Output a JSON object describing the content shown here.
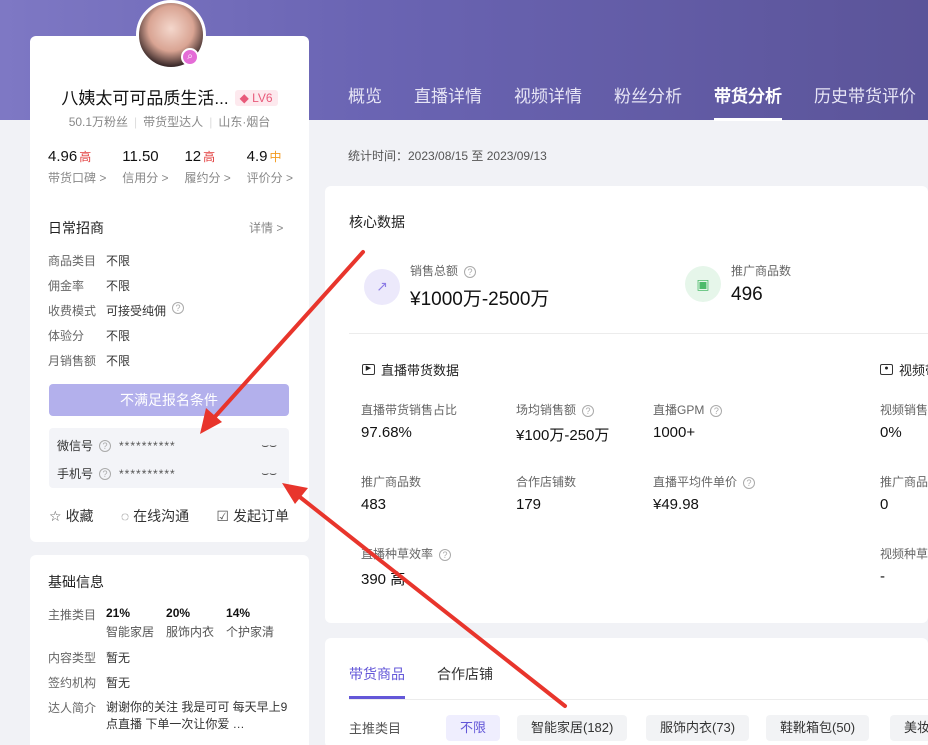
{
  "tabs": [
    "概览",
    "直播详情",
    "视频详情",
    "粉丝分析",
    "带货分析",
    "历史带货评价"
  ],
  "profile": {
    "name": "八姨太可可品质生活...",
    "level": "LV6",
    "fans": "50.1万粉丝",
    "type": "带货型达人",
    "location": "山东·烟台",
    "scores": [
      {
        "value": "4.96",
        "tag": "高",
        "level": "high",
        "label": "带货口碑 >"
      },
      {
        "value": "11.50",
        "tag": "",
        "level": "",
        "label": "信用分 >"
      },
      {
        "value": "12",
        "tag": "高",
        "level": "high",
        "label": "履约分 >"
      },
      {
        "value": "4.9",
        "tag": "中",
        "level": "mid",
        "label": "评价分 >"
      }
    ]
  },
  "recruit": {
    "title": "日常招商",
    "detail": "详情 >",
    "rows": [
      {
        "k": "商品类目",
        "v": "不限"
      },
      {
        "k": "佣金率",
        "v": "不限"
      },
      {
        "k": "收费模式",
        "v": "可接受纯佣"
      },
      {
        "k": "体验分",
        "v": "不限"
      },
      {
        "k": "月销售额",
        "v": "不限"
      }
    ],
    "apply_label": "不满足报名条件"
  },
  "contact": {
    "wechat_label": "微信号",
    "wechat_value": "**********",
    "phone_label": "手机号",
    "phone_value": "**********"
  },
  "actions": {
    "favorite": "收藏",
    "chat": "在线沟通",
    "order": "发起订单"
  },
  "base_info": {
    "title": "基础信息",
    "main_cat_label": "主推类目",
    "cats": [
      {
        "pct": "21%",
        "name": "智能家居"
      },
      {
        "pct": "20%",
        "name": "服饰内衣"
      },
      {
        "pct": "14%",
        "name": "个护家清"
      }
    ],
    "content_type_label": "内容类型",
    "content_type": "暂无",
    "agency_label": "签约机构",
    "agency": "暂无",
    "intro_label": "达人简介",
    "intro_1": "谢谢你的关注 我是可可 每天早上9",
    "intro_2": "点直播 下单一次让你爱 …"
  },
  "stat_time": "统计时间：2023/08/15 至 2023/09/13",
  "core": {
    "title": "核心数据",
    "sales_label": "销售总额",
    "sales_value": "¥1000万-2500万",
    "promo_label": "推广商品数",
    "promo_value": "496"
  },
  "live": {
    "title": "直播带货数据",
    "metrics": [
      {
        "l": "直播带货销售占比",
        "v": "97.68%"
      },
      {
        "l": "场均销售额",
        "v": "¥100万-250万"
      },
      {
        "l": "直播GPM",
        "v": "1000+"
      },
      {
        "l": "推广商品数",
        "v": "483"
      },
      {
        "l": "合作店铺数",
        "v": "179"
      },
      {
        "l": "直播平均件单价",
        "v": "¥49.98"
      },
      {
        "l": "直播种草效率",
        "v": "390 高"
      }
    ]
  },
  "video": {
    "title": "视频带",
    "metrics": [
      {
        "l": "视频销售",
        "v": "0%"
      },
      {
        "l": "推广商品",
        "v": "0"
      },
      {
        "l": "视频种草",
        "v": "-"
      }
    ]
  },
  "goods": {
    "tabs": [
      "带货商品",
      "合作店铺"
    ],
    "filter_label": "主推类目",
    "chips": [
      "不限",
      "智能家居(182)",
      "服饰内衣(73)",
      "鞋靴箱包(50)",
      "美妆"
    ]
  },
  "colors": {
    "accent": "#6357d8",
    "high": "#e23c3c",
    "mid": "#f39a1f",
    "arrow": "#e8352c"
  }
}
